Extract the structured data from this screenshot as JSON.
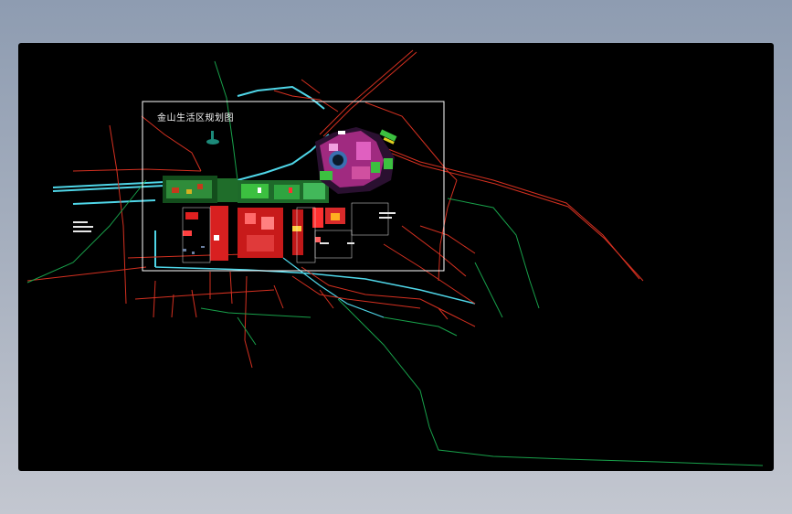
{
  "drawing": {
    "title": "金山生活区规划图"
  },
  "colors": {
    "canvas": "#000000",
    "road_red": "#d43020",
    "road_green": "#18a04a",
    "water_cyan": "#4fd6e8",
    "frame_white": "#ffffff",
    "block_red": "#ff2a2a",
    "block_magenta": "#e040b0",
    "vegetation_green": "#3cc040"
  },
  "icons": {
    "title_frame": "rectangle-outline",
    "map": "cad-plan-drawing"
  }
}
